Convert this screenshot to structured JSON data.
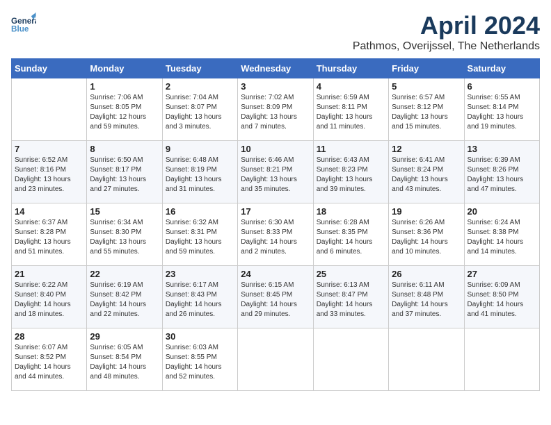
{
  "header": {
    "logo_line1": "General",
    "logo_line2": "Blue",
    "month": "April 2024",
    "location": "Pathmos, Overijssel, The Netherlands"
  },
  "weekdays": [
    "Sunday",
    "Monday",
    "Tuesday",
    "Wednesday",
    "Thursday",
    "Friday",
    "Saturday"
  ],
  "weeks": [
    [
      {
        "day": "",
        "info": ""
      },
      {
        "day": "1",
        "info": "Sunrise: 7:06 AM\nSunset: 8:05 PM\nDaylight: 12 hours\nand 59 minutes."
      },
      {
        "day": "2",
        "info": "Sunrise: 7:04 AM\nSunset: 8:07 PM\nDaylight: 13 hours\nand 3 minutes."
      },
      {
        "day": "3",
        "info": "Sunrise: 7:02 AM\nSunset: 8:09 PM\nDaylight: 13 hours\nand 7 minutes."
      },
      {
        "day": "4",
        "info": "Sunrise: 6:59 AM\nSunset: 8:11 PM\nDaylight: 13 hours\nand 11 minutes."
      },
      {
        "day": "5",
        "info": "Sunrise: 6:57 AM\nSunset: 8:12 PM\nDaylight: 13 hours\nand 15 minutes."
      },
      {
        "day": "6",
        "info": "Sunrise: 6:55 AM\nSunset: 8:14 PM\nDaylight: 13 hours\nand 19 minutes."
      }
    ],
    [
      {
        "day": "7",
        "info": "Sunrise: 6:52 AM\nSunset: 8:16 PM\nDaylight: 13 hours\nand 23 minutes."
      },
      {
        "day": "8",
        "info": "Sunrise: 6:50 AM\nSunset: 8:17 PM\nDaylight: 13 hours\nand 27 minutes."
      },
      {
        "day": "9",
        "info": "Sunrise: 6:48 AM\nSunset: 8:19 PM\nDaylight: 13 hours\nand 31 minutes."
      },
      {
        "day": "10",
        "info": "Sunrise: 6:46 AM\nSunset: 8:21 PM\nDaylight: 13 hours\nand 35 minutes."
      },
      {
        "day": "11",
        "info": "Sunrise: 6:43 AM\nSunset: 8:23 PM\nDaylight: 13 hours\nand 39 minutes."
      },
      {
        "day": "12",
        "info": "Sunrise: 6:41 AM\nSunset: 8:24 PM\nDaylight: 13 hours\nand 43 minutes."
      },
      {
        "day": "13",
        "info": "Sunrise: 6:39 AM\nSunset: 8:26 PM\nDaylight: 13 hours\nand 47 minutes."
      }
    ],
    [
      {
        "day": "14",
        "info": "Sunrise: 6:37 AM\nSunset: 8:28 PM\nDaylight: 13 hours\nand 51 minutes."
      },
      {
        "day": "15",
        "info": "Sunrise: 6:34 AM\nSunset: 8:30 PM\nDaylight: 13 hours\nand 55 minutes."
      },
      {
        "day": "16",
        "info": "Sunrise: 6:32 AM\nSunset: 8:31 PM\nDaylight: 13 hours\nand 59 minutes."
      },
      {
        "day": "17",
        "info": "Sunrise: 6:30 AM\nSunset: 8:33 PM\nDaylight: 14 hours\nand 2 minutes."
      },
      {
        "day": "18",
        "info": "Sunrise: 6:28 AM\nSunset: 8:35 PM\nDaylight: 14 hours\nand 6 minutes."
      },
      {
        "day": "19",
        "info": "Sunrise: 6:26 AM\nSunset: 8:36 PM\nDaylight: 14 hours\nand 10 minutes."
      },
      {
        "day": "20",
        "info": "Sunrise: 6:24 AM\nSunset: 8:38 PM\nDaylight: 14 hours\nand 14 minutes."
      }
    ],
    [
      {
        "day": "21",
        "info": "Sunrise: 6:22 AM\nSunset: 8:40 PM\nDaylight: 14 hours\nand 18 minutes."
      },
      {
        "day": "22",
        "info": "Sunrise: 6:19 AM\nSunset: 8:42 PM\nDaylight: 14 hours\nand 22 minutes."
      },
      {
        "day": "23",
        "info": "Sunrise: 6:17 AM\nSunset: 8:43 PM\nDaylight: 14 hours\nand 26 minutes."
      },
      {
        "day": "24",
        "info": "Sunrise: 6:15 AM\nSunset: 8:45 PM\nDaylight: 14 hours\nand 29 minutes."
      },
      {
        "day": "25",
        "info": "Sunrise: 6:13 AM\nSunset: 8:47 PM\nDaylight: 14 hours\nand 33 minutes."
      },
      {
        "day": "26",
        "info": "Sunrise: 6:11 AM\nSunset: 8:48 PM\nDaylight: 14 hours\nand 37 minutes."
      },
      {
        "day": "27",
        "info": "Sunrise: 6:09 AM\nSunset: 8:50 PM\nDaylight: 14 hours\nand 41 minutes."
      }
    ],
    [
      {
        "day": "28",
        "info": "Sunrise: 6:07 AM\nSunset: 8:52 PM\nDaylight: 14 hours\nand 44 minutes."
      },
      {
        "day": "29",
        "info": "Sunrise: 6:05 AM\nSunset: 8:54 PM\nDaylight: 14 hours\nand 48 minutes."
      },
      {
        "day": "30",
        "info": "Sunrise: 6:03 AM\nSunset: 8:55 PM\nDaylight: 14 hours\nand 52 minutes."
      },
      {
        "day": "",
        "info": ""
      },
      {
        "day": "",
        "info": ""
      },
      {
        "day": "",
        "info": ""
      },
      {
        "day": "",
        "info": ""
      }
    ]
  ]
}
